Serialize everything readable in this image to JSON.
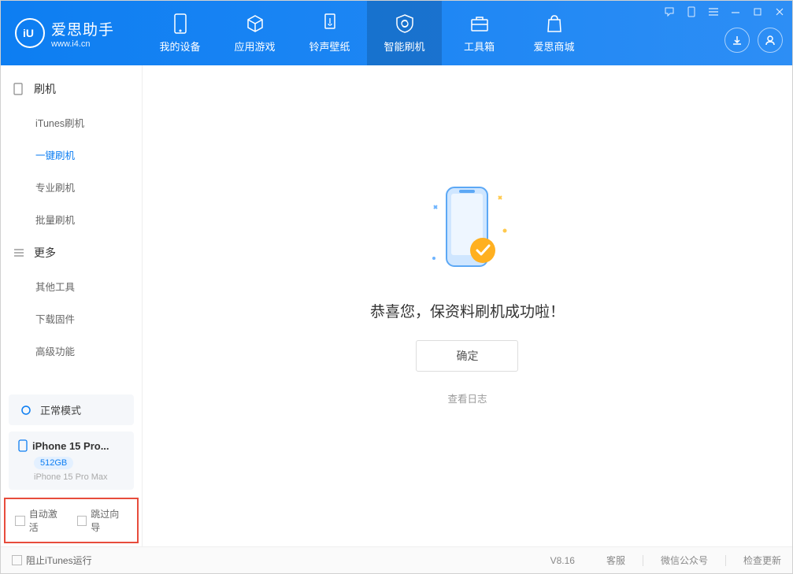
{
  "brand": {
    "title": "爱思助手",
    "url": "www.i4.cn"
  },
  "nav": {
    "items": [
      {
        "label": "我的设备"
      },
      {
        "label": "应用游戏"
      },
      {
        "label": "铃声壁纸"
      },
      {
        "label": "智能刷机"
      },
      {
        "label": "工具箱"
      },
      {
        "label": "爱思商城"
      }
    ]
  },
  "sidebar": {
    "groups": [
      {
        "title": "刷机",
        "items": [
          {
            "label": "iTunes刷机"
          },
          {
            "label": "一键刷机"
          },
          {
            "label": "专业刷机"
          },
          {
            "label": "批量刷机"
          }
        ]
      },
      {
        "title": "更多",
        "items": [
          {
            "label": "其他工具"
          },
          {
            "label": "下载固件"
          },
          {
            "label": "高级功能"
          }
        ]
      }
    ],
    "mode": "正常模式",
    "device": {
      "name": "iPhone 15 Pro...",
      "storage": "512GB",
      "model": "iPhone 15 Pro Max"
    },
    "checks": {
      "auto_activate": "自动激活",
      "skip_wizard": "跳过向导"
    }
  },
  "main": {
    "success_message": "恭喜您，保资料刷机成功啦！",
    "ok_button": "确定",
    "view_log": "查看日志"
  },
  "footer": {
    "block_itunes": "阻止iTunes运行",
    "version": "V8.16",
    "links": {
      "support": "客服",
      "wechat": "微信公众号",
      "check_update": "检查更新"
    }
  }
}
